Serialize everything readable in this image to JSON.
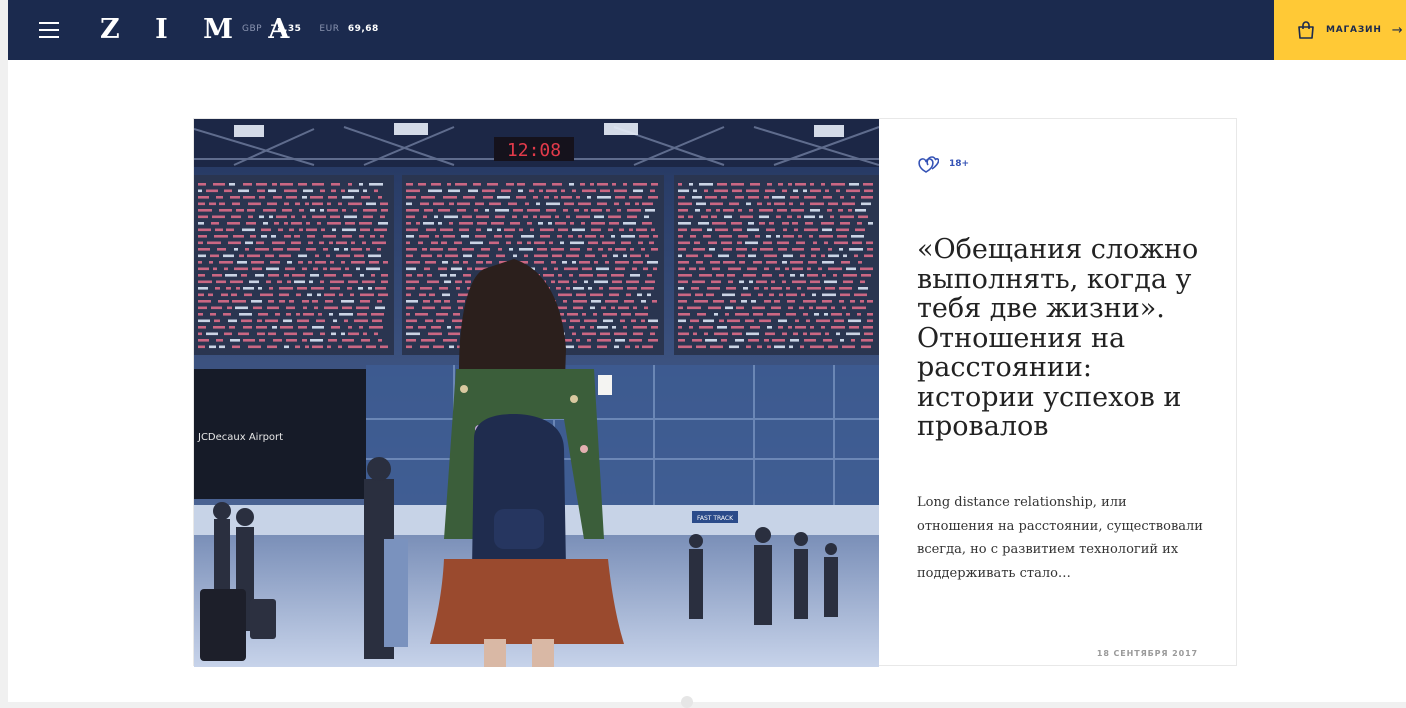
{
  "header": {
    "logo": "Z I M A",
    "rates": [
      {
        "code": "GBP",
        "value": "78,35"
      },
      {
        "code": "EUR",
        "value": "69,68"
      }
    ],
    "shop_label": "МАГАЗИН",
    "shop_arrow": "→",
    "menu_icon": "hamburger-icon",
    "shop_icon": "shopping-bag-icon"
  },
  "article": {
    "tag_icon": "hearts-icon",
    "tag_label": "18+",
    "headline": "«Обещания сложно выполнять, когда у тебя две жизни». Отношения на расстоянии: истории успехов и провалов",
    "excerpt": "Long distance relationship, или отношения на расстоянии, существовали всегда, но с развитием технологий их поддерживать стало…",
    "date": "18 СЕНТЯБРЯ 2017",
    "image_board_clock": "12:08",
    "image_ad_text": "JCDecaux Airport",
    "image_sign_text": "FAST TRACK"
  },
  "colors": {
    "header_bg": "#1b2a4e",
    "shop_bg": "#ffc936",
    "tag_color": "#3452b5"
  }
}
